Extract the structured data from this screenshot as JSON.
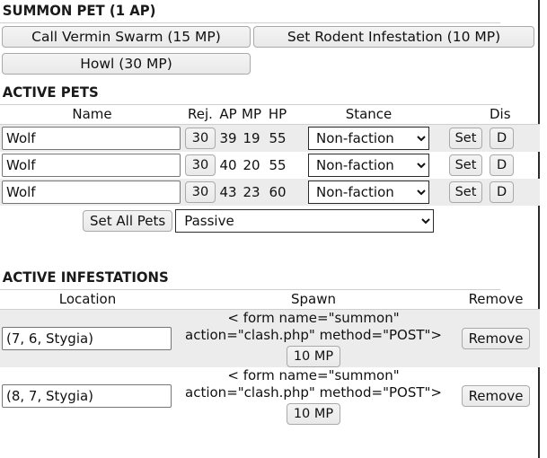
{
  "summon_pet": {
    "title": "SUMMON PET (1 AP)",
    "abilities": [
      {
        "label": "Call Vermin Swarm (15 MP)"
      },
      {
        "label": "Set Rodent Infestation (10 MP)"
      },
      {
        "label": "Howl (30 MP)"
      }
    ]
  },
  "active_pets": {
    "title": "ACTIVE PETS",
    "columns": {
      "name": "Name",
      "rej": "Rej.",
      "ap": "AP",
      "mp": "MP",
      "hp": "HP",
      "stance": "Stance",
      "dismiss": "Dis"
    },
    "rows": [
      {
        "name": "Wolf",
        "rej": "30",
        "ap": "39",
        "mp": "19",
        "hp": "55",
        "stance": "Non-faction",
        "set": "Set",
        "dismiss": "D"
      },
      {
        "name": "Wolf",
        "rej": "30",
        "ap": "40",
        "mp": "20",
        "hp": "55",
        "stance": "Non-faction",
        "set": "Set",
        "dismiss": "D"
      },
      {
        "name": "Wolf",
        "rej": "30",
        "ap": "43",
        "mp": "23",
        "hp": "60",
        "stance": "Non-faction",
        "set": "Set",
        "dismiss": "D"
      }
    ],
    "set_all": {
      "button_label": "Set All Pets",
      "selected_stance": "Passive"
    }
  },
  "active_infestations": {
    "title": "ACTIVE INFESTATIONS",
    "columns": {
      "location": "Location",
      "spawn": "Spawn",
      "remove": "Remove"
    },
    "rows": [
      {
        "location": "(7, 6, Stygia)",
        "spawn_text": "< form name=\"summon\" action=\"clash.php\" method=\"POST\">",
        "spawn_button": "10 MP",
        "remove": "Remove"
      },
      {
        "location": "(8, 7, Stygia)",
        "spawn_text": "< form name=\"summon\" action=\"clash.php\" method=\"POST\">",
        "spawn_button": "10 MP",
        "remove": "Remove"
      }
    ]
  }
}
